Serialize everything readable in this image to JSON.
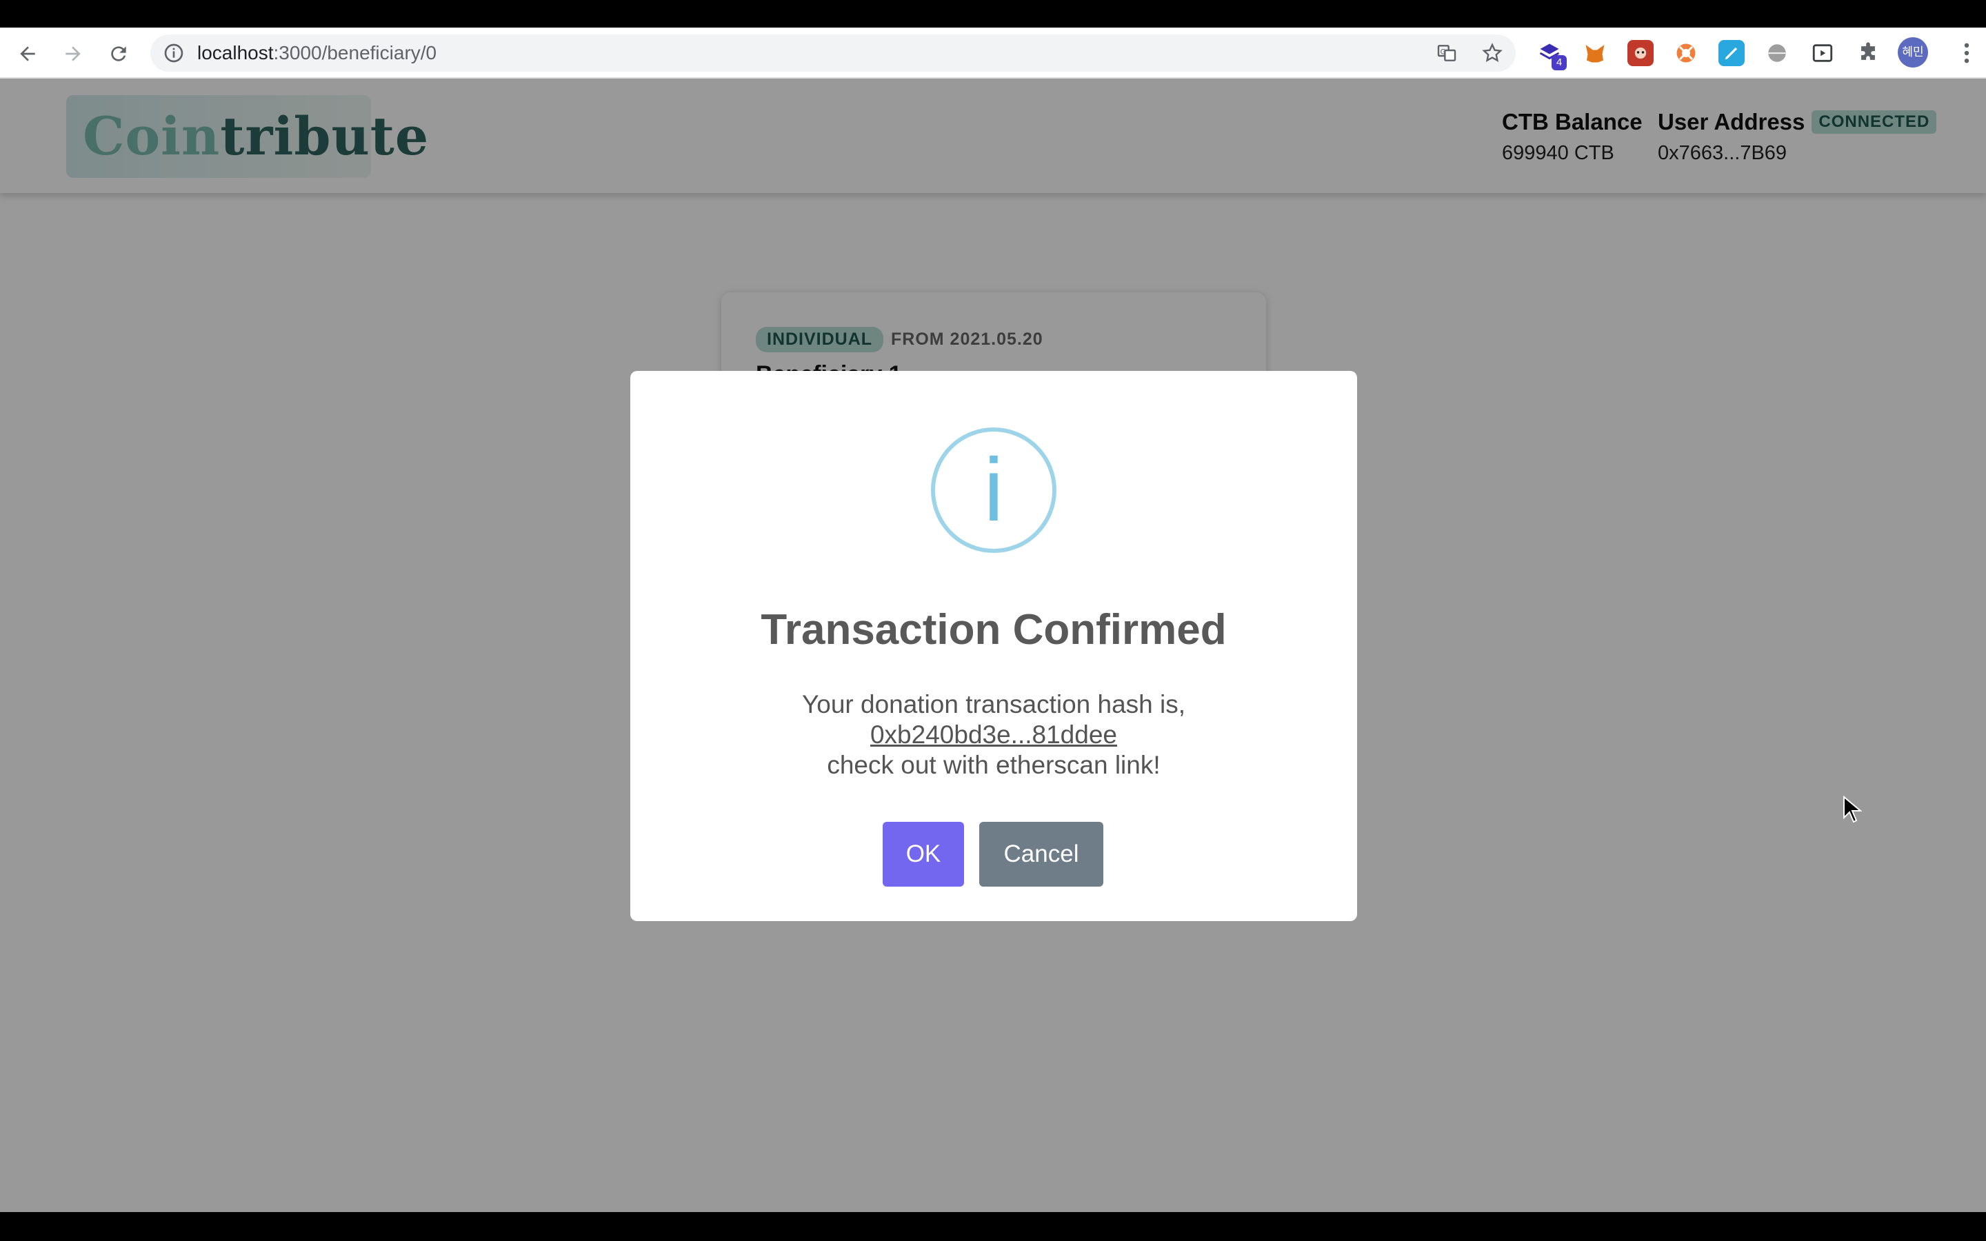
{
  "browser": {
    "url_host": "localhost",
    "url_path": ":3000/beneficiary/0",
    "extension_badge_count": "4",
    "profile_initials": "혜민"
  },
  "site": {
    "logo_part1": "Coin",
    "logo_part2": "tribute",
    "balance_title": "CTB Balance",
    "balance_value": "699940 CTB",
    "address_title": "User Address",
    "address_status": "CONNECTED",
    "address_value": "0x7663...7B69"
  },
  "card": {
    "tag": "INDIVIDUAL",
    "from": "FROM 2021.05.20",
    "title": "Beneficiary 1"
  },
  "modal": {
    "icon": "i",
    "title": "Transaction Confirmed",
    "body_line1": "Your donation transaction hash is,",
    "hash_link": "0xb240bd3e...81ddee",
    "body_line3": "check out with etherscan link!",
    "ok_label": "OK",
    "cancel_label": "Cancel"
  },
  "colors": {
    "accent": "#7367f0",
    "cancel": "#6e7d88",
    "info": "#9dd4ea",
    "brand": "#2e6560"
  }
}
